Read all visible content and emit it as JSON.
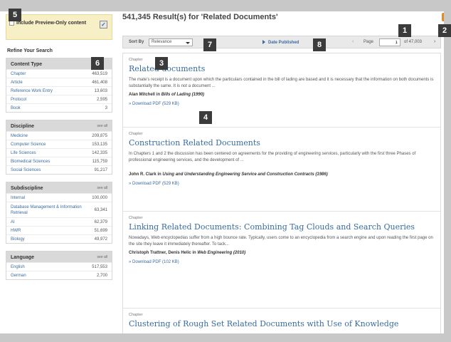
{
  "header": {
    "results_title": "541,345 Result(s) for 'Related Documents'"
  },
  "sidebar": {
    "preview_only_label": "Include Preview-Only content",
    "refine_title": "Refine Your Search",
    "facets": [
      {
        "title": "Content Type",
        "see_all": "",
        "items": [
          {
            "label": "Chapter",
            "count": "463,519"
          },
          {
            "label": "Article",
            "count": "461,408"
          },
          {
            "label": "Reference Work Entry",
            "count": "13,603"
          },
          {
            "label": "Protocol",
            "count": "2,595"
          },
          {
            "label": "Book",
            "count": "3"
          }
        ]
      },
      {
        "title": "Discipline",
        "see_all": "see all",
        "items": [
          {
            "label": "Medicine",
            "count": "209,875"
          },
          {
            "label": "Computer Science",
            "count": "153,135"
          },
          {
            "label": "Life Sciences",
            "count": "142,335"
          },
          {
            "label": "Biomedical Sciences",
            "count": "115,759"
          },
          {
            "label": "Social Sciences",
            "count": "91,217"
          }
        ]
      },
      {
        "title": "Subdiscipline",
        "see_all": "see all",
        "items": [
          {
            "label": "Internal",
            "count": "100,000"
          },
          {
            "label": "Database Management & Information Retrieval",
            "count": "63,341"
          },
          {
            "label": "AI",
            "count": "62,379"
          },
          {
            "label": "HWR",
            "count": "51,699"
          },
          {
            "label": "Biology",
            "count": "49,972"
          }
        ]
      },
      {
        "title": "Language",
        "see_all": "see all",
        "items": [
          {
            "label": "English",
            "count": "517,553"
          },
          {
            "label": "German",
            "count": "2,700"
          }
        ]
      }
    ]
  },
  "toolbar": {
    "sort_label": "Sort By",
    "sort_value": "Relevance",
    "date_published": "Date Published",
    "prev": "‹",
    "page_label": "Page",
    "page_value": "1",
    "page_total": "of 47,003",
    "next": "›"
  },
  "results": [
    {
      "type": "Chapter",
      "title": "Related documents",
      "snippet": "The mate's receipt is a document upon which the particulars contained in the bill of lading are based and it is necessary that the information on both documents is substantially the same. It is not a document ...",
      "author": "Alan Mitchell in",
      "source": "Bills of Lading (1990)",
      "download": "» Download PDF (529 KB)"
    },
    {
      "type": "Chapter",
      "title": "Construction Related Documents",
      "snippet": "In Chapters 1 and 2 the discussion has been centered on agreements for the providing of engineering services, particularly with the first three Phases of professional engineering services, and the development of ...",
      "author": "John R. Clark in",
      "source": "Using and Understanding Engineering Service and Construction Contracts (1986)",
      "download": "» Download PDF (529 KB)"
    },
    {
      "type": "Chapter",
      "title": "Linking Related Documents: Combining Tag Clouds and Search Queries",
      "snippet": "Nowadays, Web encyclopedias suffer from a high bounce rate. Typically, users come to an encyclopedia from a search engine and upon reading the first page on the site they leave it immediately thereafter. To tack...",
      "author": "Christoph Trattner, Denis Helic in",
      "source": "Web Engineering (2010)",
      "download": "» Download PDF (102 KB)"
    },
    {
      "type": "Chapter",
      "title": "Clustering of Rough Set Related Documents with Use of Knowledge",
      "snippet": "",
      "author": "",
      "source": "",
      "download": ""
    }
  ],
  "callouts": [
    "1",
    "2",
    "3",
    "4",
    "5",
    "6",
    "7",
    "8"
  ]
}
